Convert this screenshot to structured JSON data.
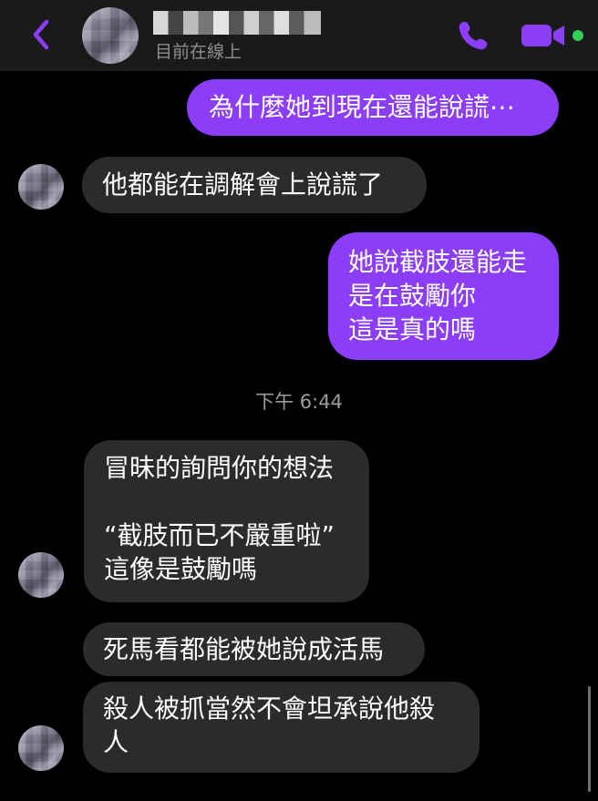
{
  "header": {
    "status": "目前在線上",
    "back_icon": "chevron-left-icon",
    "call_icon": "phone-icon",
    "video_icon": "video-camera-icon",
    "accent_color": "#8b3df7",
    "online_color": "#31d158"
  },
  "messages": [
    {
      "sender": "me",
      "text": "為什麼她到現在還能說謊⋯"
    },
    {
      "sender": "other",
      "text": "他都能在調解會上說謊了"
    },
    {
      "sender": "me",
      "text": "她說截肢還能走\n是在鼓勵你\n這是真的嗎"
    },
    {
      "sender": "other",
      "text": "冒昧的詢問你的想法\n\n“截肢而已不嚴重啦”\n這像是鼓勵嗎"
    },
    {
      "sender": "other",
      "text": "死馬看都能被她說成活馬"
    },
    {
      "sender": "other",
      "text": "殺人被抓當然不會坦承說他殺\n人"
    }
  ],
  "timestamp": "下午 6:44",
  "colors": {
    "background": "#000000",
    "header_background": "#1a1a1a",
    "received_bubble": "#2b2b2b",
    "sent_bubble": "#8b3df7",
    "secondary_text": "#9b9ba0"
  }
}
